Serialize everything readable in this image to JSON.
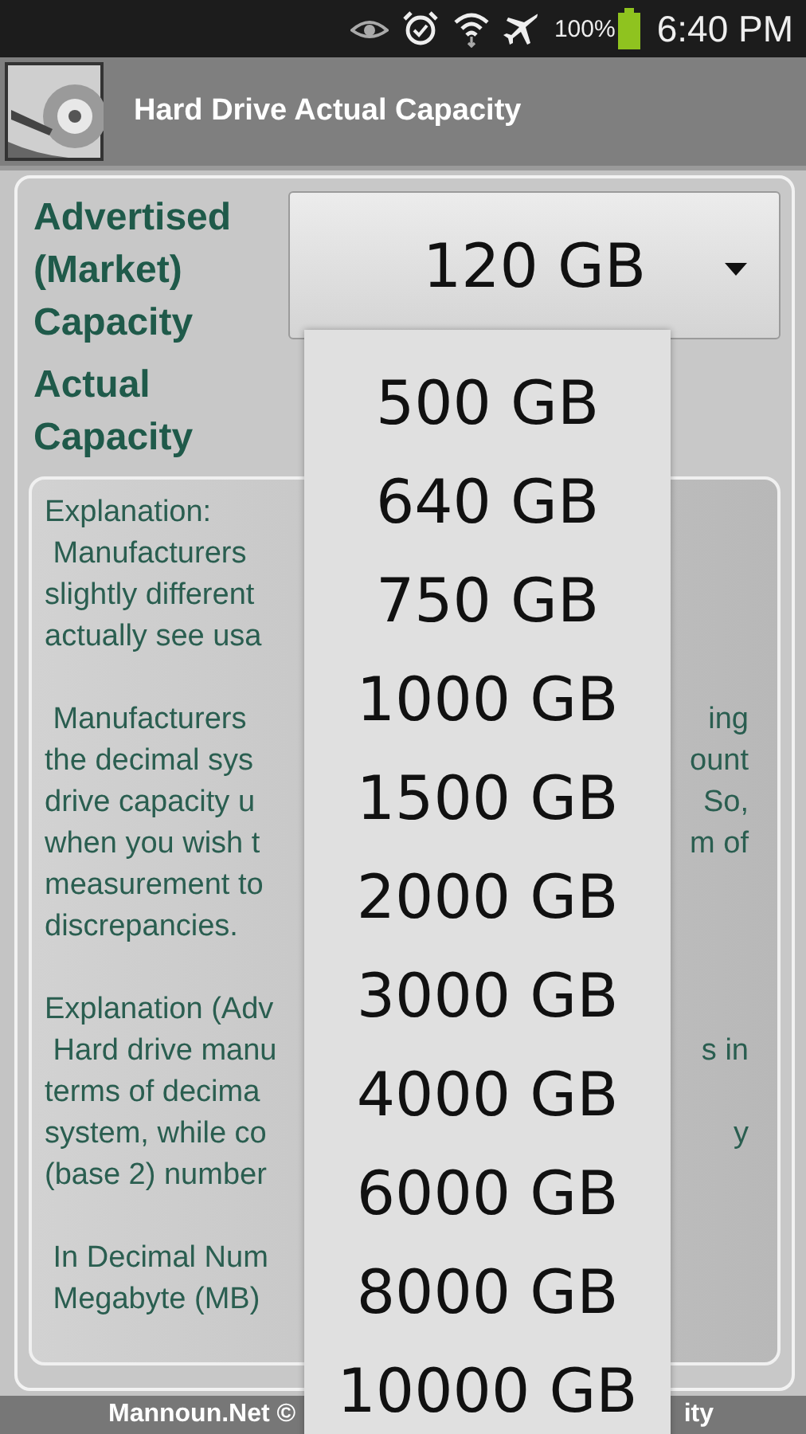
{
  "status_bar": {
    "battery_text": "100%",
    "time": "6:40 PM"
  },
  "app_bar": {
    "title": "Hard Drive Actual Capacity"
  },
  "form": {
    "advertised_label": "Advertised (Market) Capacity",
    "selected_value": "120 GB",
    "actual_label": "Actual Capacity"
  },
  "explanation_lines": [
    {
      "left": "Explanation:"
    },
    {
      "left": " Manufacturers"
    },
    {
      "left": "slightly different"
    },
    {
      "left": "actually see usa"
    },
    {
      "left": " Manufacturers",
      "right": "ing",
      "blank_before": true
    },
    {
      "left": "the decimal sys",
      "right": "ount"
    },
    {
      "left": "drive capacity u",
      "right": "So,"
    },
    {
      "left": "when you wish t",
      "right": "m of"
    },
    {
      "left": "measurement to"
    },
    {
      "left": "discrepancies."
    },
    {
      "left": "Explanation (Adv",
      "blank_before": true
    },
    {
      "left": " Hard drive manu",
      "right": "s in"
    },
    {
      "left": "terms of decima"
    },
    {
      "left": "system, while co",
      "right": "y"
    },
    {
      "left": "(base 2) number"
    },
    {
      "left": " In Decimal Num",
      "blank_before": true
    },
    {
      "left": " Megabyte (MB)"
    }
  ],
  "footer": {
    "left": "Mannoun.Net ©",
    "right": "ity"
  },
  "dropdown": {
    "options": [
      {
        "label": "500 GB",
        "selected": false
      },
      {
        "label": "640 GB",
        "selected": false
      },
      {
        "label": "750 GB",
        "selected": false
      },
      {
        "label": "1000 GB",
        "selected": false
      },
      {
        "label": "1500 GB",
        "selected": false
      },
      {
        "label": "2000 GB",
        "selected": false
      },
      {
        "label": "3000 GB",
        "selected": false
      },
      {
        "label": "4000 GB",
        "selected": false
      },
      {
        "label": "6000 GB",
        "selected": false
      },
      {
        "label": "8000 GB",
        "selected": false
      },
      {
        "label": "10000 GB",
        "selected": false
      }
    ]
  }
}
